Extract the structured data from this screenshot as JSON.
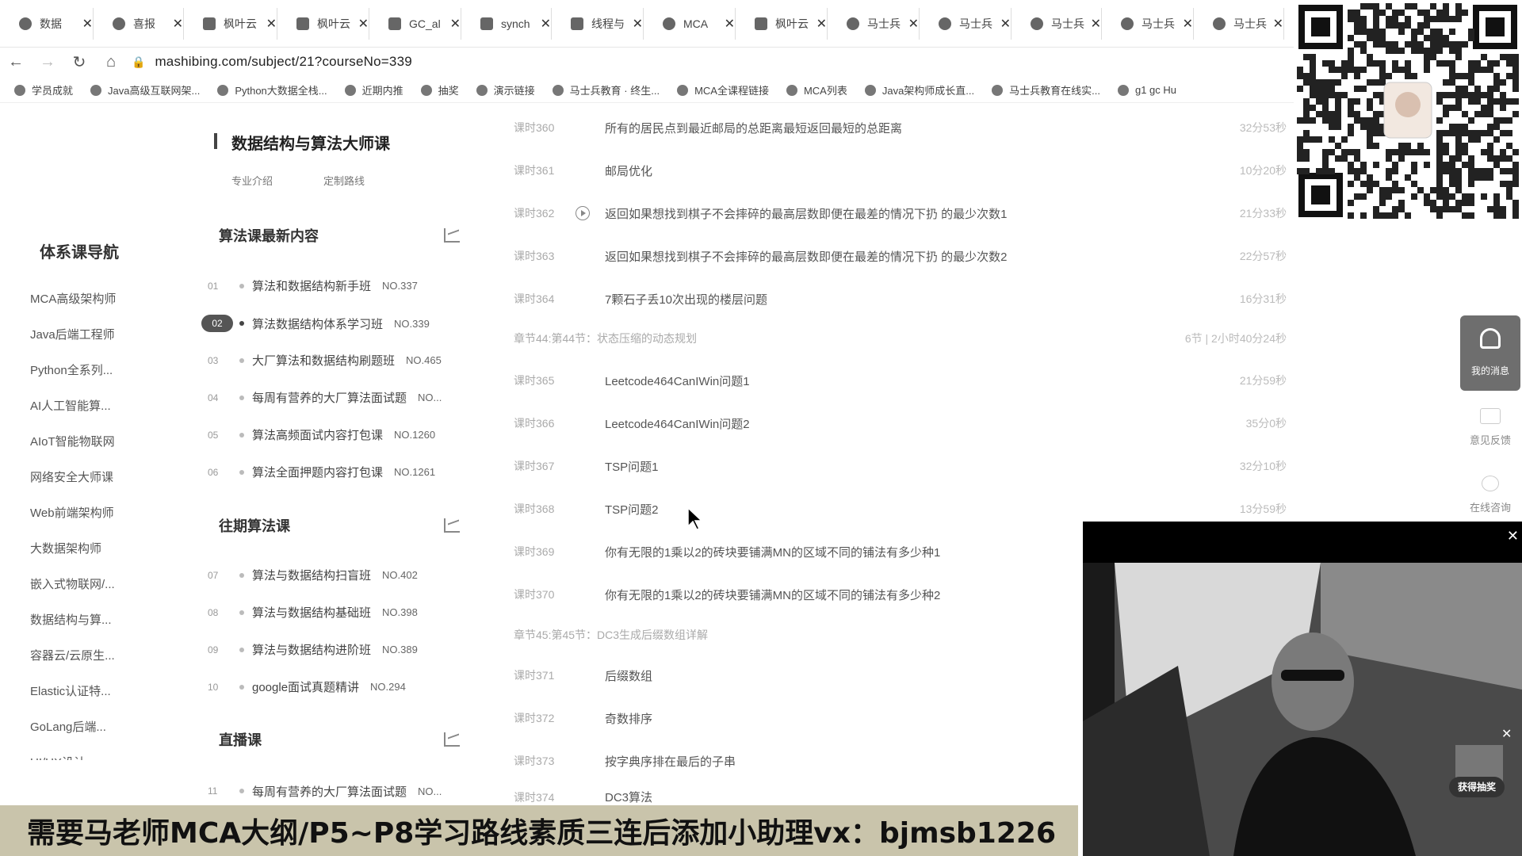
{
  "browser": {
    "tabs": [
      {
        "label": "数据"
      },
      {
        "label": "喜报"
      },
      {
        "label": "枫叶云"
      },
      {
        "label": "枫叶云"
      },
      {
        "label": "GC_al"
      },
      {
        "label": "synch"
      },
      {
        "label": "线程与"
      },
      {
        "label": "MCA"
      },
      {
        "label": "枫叶云"
      },
      {
        "label": "马士兵"
      },
      {
        "label": "马士兵"
      },
      {
        "label": "马士兵"
      },
      {
        "label": "马士兵"
      },
      {
        "label": "马士兵"
      }
    ],
    "url": "mashibing.com/subject/21?courseNo=339",
    "bookmarks": [
      "学员成就",
      "Java高级互联网架...",
      "Python大数据全栈...",
      "近期内推",
      "抽奖",
      "演示链接",
      "马士兵教育 · 终生...",
      "MCA全课程链接",
      "MCA列表",
      "Java架构师成长直...",
      "马士兵教育在线实...",
      "g1 gc Hu"
    ]
  },
  "leftnav": {
    "title": "体系课导航",
    "items": [
      "MCA高级架构师",
      "Java后端工程师",
      "Python全系列...",
      "AI人工智能算...",
      "AIoT智能物联网",
      "网络安全大师课",
      "Web前端架构师",
      "大数据架构师",
      "嵌入式物联网/...",
      "数据结构与算...",
      "容器云/云原生...",
      "Elastic认证特...",
      "GoLang后端...",
      "UI/UX设计..."
    ]
  },
  "course": {
    "title": "数据结构与算法大师课",
    "subtabs": [
      "专业介绍",
      "定制路线"
    ]
  },
  "sections": [
    {
      "title": "算法课最新内容",
      "rows": [
        {
          "num": "01",
          "title": "算法和数据结构新手班",
          "no": "NO.337"
        },
        {
          "num": "02",
          "title": "算法数据结构体系学习班",
          "no": "NO.339"
        },
        {
          "num": "03",
          "title": "大厂算法和数据结构刷题班",
          "no": "NO.465"
        },
        {
          "num": "04",
          "title": "每周有营养的大厂算法面试题",
          "no": "NO..."
        },
        {
          "num": "05",
          "title": "算法高频面试内容打包课",
          "no": "NO.1260"
        },
        {
          "num": "06",
          "title": "算法全面押题内容打包课",
          "no": "NO.1261"
        }
      ]
    },
    {
      "title": "往期算法课",
      "rows": [
        {
          "num": "07",
          "title": "算法与数据结构扫盲班",
          "no": "NO.402"
        },
        {
          "num": "08",
          "title": "算法与数据结构基础班",
          "no": "NO.398"
        },
        {
          "num": "09",
          "title": "算法与数据结构进阶班",
          "no": "NO.389"
        },
        {
          "num": "10",
          "title": "google面试真题精讲",
          "no": "NO.294"
        }
      ]
    },
    {
      "title": "直播课",
      "rows": [
        {
          "num": "11",
          "title": "每周有营养的大厂算法面试题",
          "no": "NO..."
        }
      ]
    }
  ],
  "lessons": [
    {
      "kind": "lesson",
      "no": "课时360",
      "title": "所有的居民点到最近邮局的总距离最短返回最短的总距离",
      "dur": "32分53秒"
    },
    {
      "kind": "lesson",
      "no": "课时361",
      "title": "邮局优化",
      "dur": "10分20秒"
    },
    {
      "kind": "lesson",
      "no": "课时362",
      "title": "返回如果想找到棋子不会摔碎的最高层数即便在最差的情况下扔 的最少次数1",
      "dur": "21分33秒",
      "playing": true
    },
    {
      "kind": "lesson",
      "no": "课时363",
      "title": "返回如果想找到棋子不会摔碎的最高层数即便在最差的情况下扔 的最少次数2",
      "dur": "22分57秒"
    },
    {
      "kind": "lesson",
      "no": "课时364",
      "title": "7颗石子丢10次出现的楼层问题",
      "dur": "16分31秒"
    },
    {
      "kind": "chapter",
      "title": "章节44:第44节：状态压缩的动态规划",
      "info": "6节 | 2小时40分24秒"
    },
    {
      "kind": "lesson",
      "no": "课时365",
      "title": "Leetcode464CanIWin问题1",
      "dur": "21分59秒"
    },
    {
      "kind": "lesson",
      "no": "课时366",
      "title": "Leetcode464CanIWin问题2",
      "dur": "35分0秒"
    },
    {
      "kind": "lesson",
      "no": "课时367",
      "title": "TSP问题1",
      "dur": "32分10秒"
    },
    {
      "kind": "lesson",
      "no": "课时368",
      "title": "TSP问题2",
      "dur": "13分59秒"
    },
    {
      "kind": "lesson",
      "no": "课时369",
      "title": "你有无限的1乘以2的砖块要铺满MN的区域不同的铺法有多少种1",
      "dur": ""
    },
    {
      "kind": "lesson",
      "no": "课时370",
      "title": "你有无限的1乘以2的砖块要铺满MN的区域不同的铺法有多少种2",
      "dur": ""
    },
    {
      "kind": "chapter",
      "title": "章节45:第45节：DC3生成后缀数组详解",
      "info": ""
    },
    {
      "kind": "lesson",
      "no": "课时371",
      "title": "后缀数组",
      "dur": ""
    },
    {
      "kind": "lesson",
      "no": "课时372",
      "title": "奇数排序",
      "dur": ""
    },
    {
      "kind": "lesson",
      "no": "课时373",
      "title": "按字典序排在最后的子串",
      "dur": ""
    },
    {
      "kind": "lesson",
      "no": "课时374",
      "title": "DC3算法",
      "dur": ""
    }
  ],
  "sidebar_right": {
    "message_label": "我的消息",
    "feedback_label": "意见反馈",
    "online_label": "在线咨询"
  },
  "video": {
    "gift_label": "获得抽奖"
  },
  "banner": {
    "text": "需要马老师MCA大纲/P5~P8学习路线素质三连后添加小助理vx：bjmsb1226"
  }
}
